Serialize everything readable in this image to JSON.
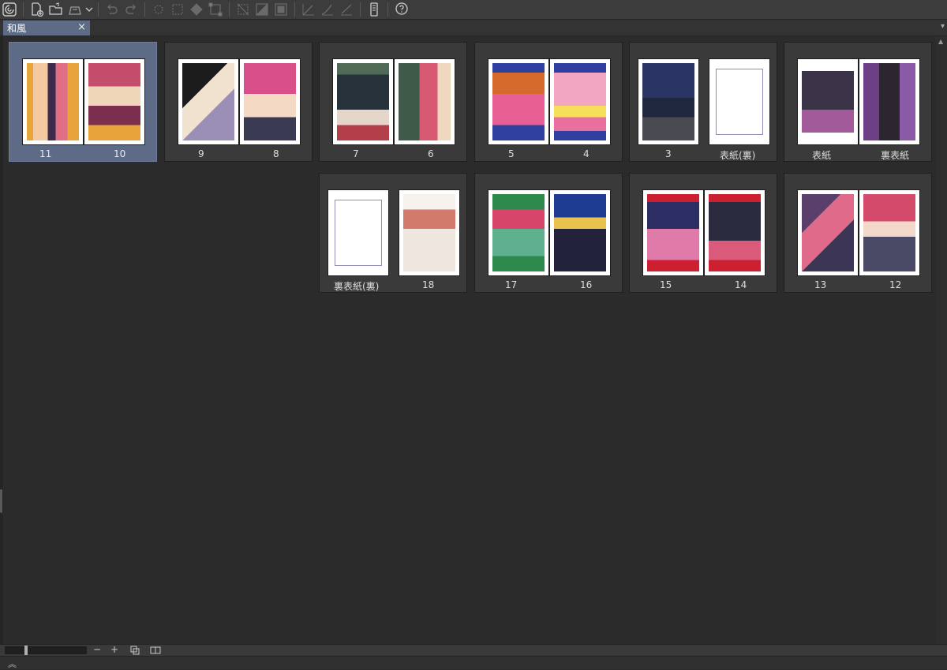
{
  "document_tab": {
    "title": "和風",
    "close_glyph": "×"
  },
  "toolbar": {
    "icons": [
      "clip-logo-icon",
      "new-page-icon",
      "open-folder-icon",
      "export-icon",
      "undo-icon",
      "redo-icon",
      "clear-icon",
      "select-all-icon",
      "fill-icon",
      "transform-icon",
      "deselect-icon",
      "invert-selection-icon",
      "show-selection-icon",
      "ruler-icon",
      "ruler-pen-icon",
      "ruler-line-icon",
      "device-icon",
      "help-icon"
    ]
  },
  "spreads": [
    {
      "left_label": "11",
      "right_label": "10",
      "selected": true
    },
    {
      "left_label": "9",
      "right_label": "8",
      "selected": false
    },
    {
      "left_label": "7",
      "right_label": "6",
      "selected": false
    },
    {
      "left_label": "5",
      "right_label": "4",
      "selected": false
    },
    {
      "left_label": "3",
      "right_label": "表紙(裏)",
      "selected": false
    },
    {
      "left_label": "表紙",
      "right_label": "裏表紙",
      "selected": false
    },
    {
      "left_label": "裏表紙(裏)",
      "right_label": "18",
      "selected": false
    },
    {
      "left_label": "17",
      "right_label": "16",
      "selected": false
    },
    {
      "left_label": "15",
      "right_label": "14",
      "selected": false
    },
    {
      "left_label": "13",
      "right_label": "12",
      "selected": false
    }
  ],
  "bottom_bar": {
    "zoom_out": "−",
    "zoom_in": "+"
  },
  "status_bar": {
    "expand_glyph": "︽"
  },
  "colors": {
    "accent": "#5d6b86",
    "background": "#2b2b2b",
    "card": "#3a3a3a"
  }
}
